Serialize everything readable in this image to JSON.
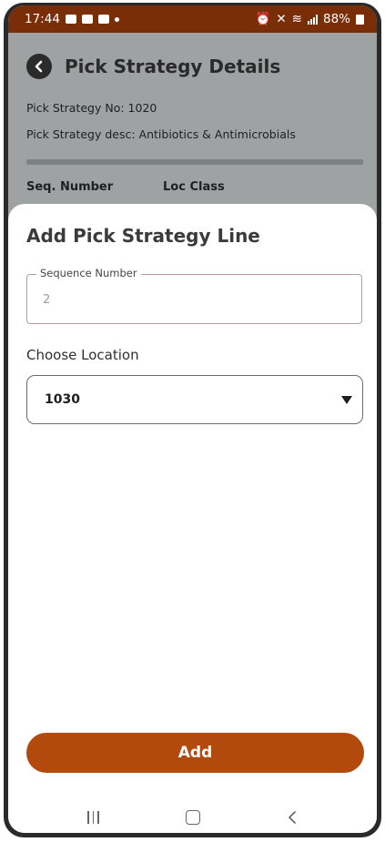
{
  "status_bar": {
    "time": "17:44",
    "battery": "88%"
  },
  "background_page": {
    "title": "Pick Strategy Details",
    "strategy_no": "Pick Strategy No: 1020",
    "strategy_desc": "Pick Strategy desc: Antibiotics & Antimicrobials",
    "columns": [
      "Seq. Number",
      "Loc Class"
    ]
  },
  "sheet": {
    "title": "Add Pick Strategy Line",
    "sequence_field": {
      "label": "Sequence Number",
      "value": "2"
    },
    "choose_location_label": "Choose Location",
    "location_select": {
      "selected": "1030"
    },
    "add_button": "Add"
  },
  "colors": {
    "status_bar": "#7a2e08",
    "accent": "#b24a0e",
    "overlay": "#9ea2a3"
  }
}
